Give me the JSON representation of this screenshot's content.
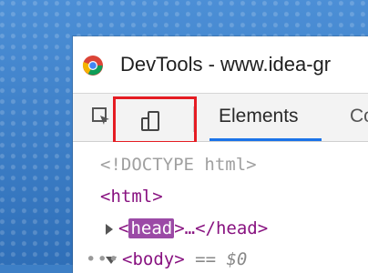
{
  "window": {
    "title": "DevTools - www.idea-gr",
    "app_icon": "chrome-icon"
  },
  "toolbar": {
    "inspect_icon": "inspect-element-icon",
    "device_icon": "device-toolbar-icon",
    "tabs": [
      {
        "label": "Elements",
        "active": true
      },
      {
        "label": "Co",
        "active": false
      }
    ]
  },
  "code": {
    "doctype": "<!DOCTYPE html>",
    "html_open": "<html>",
    "head_line": {
      "open_lt": "<",
      "tag": "head",
      "rest": ">…</head>"
    },
    "body_line": {
      "prefix": "•••",
      "open_lt": "<",
      "tag": "body",
      "gt": ">",
      "eq": "==",
      "ref": "$0"
    }
  },
  "colors": {
    "highlight_border": "#e51c23",
    "tab_underline": "#1a73e8",
    "tag": "#881280",
    "doctype": "#a0a0a0",
    "head_highlight": "#9b4aa6"
  }
}
